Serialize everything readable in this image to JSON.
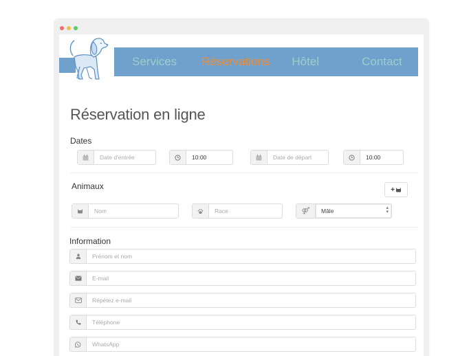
{
  "window": {
    "controls": [
      {
        "name": "close",
        "color": "#f26b6b"
      },
      {
        "name": "minimize",
        "color": "#f5c04a"
      },
      {
        "name": "maximize",
        "color": "#5ccb5f"
      }
    ]
  },
  "colors": {
    "nav_bar": "#6fa1cc",
    "nav_text": "#9ccfca",
    "nav_active": "#f28c2e"
  },
  "nav": {
    "logo_icon": "dog-logo-icon",
    "items": [
      {
        "label": "Services",
        "active": false
      },
      {
        "label": "Réservations",
        "active": true
      },
      {
        "label": "Hôtel",
        "active": false
      },
      {
        "label": "Contact",
        "active": false
      }
    ]
  },
  "page": {
    "title": "Réservation en ligne"
  },
  "dates": {
    "label": "Dates",
    "arrival_date": {
      "icon": "calendar-icon",
      "placeholder": "Date d'entrée",
      "value": ""
    },
    "arrival_time": {
      "icon": "clock-icon",
      "value": "10:00"
    },
    "departure_date": {
      "icon": "calendar-icon",
      "placeholder": "Date de départ",
      "value": ""
    },
    "departure_time": {
      "icon": "clock-icon",
      "value": "10:00"
    }
  },
  "animals": {
    "label": "Animaux",
    "add_button": {
      "icon": "plus-icon",
      "icon2": "pet-icon"
    },
    "name": {
      "icon": "pet-icon",
      "placeholder": "Nom",
      "value": ""
    },
    "breed": {
      "icon": "paw-icon",
      "placeholder": "Race",
      "value": ""
    },
    "sex": {
      "icon": "gender-icon",
      "selected": "Mâle"
    }
  },
  "information": {
    "label": "Information",
    "fields": [
      {
        "icon": "user-icon",
        "placeholder": "Prénom et nom"
      },
      {
        "icon": "envelope-icon",
        "placeholder": "E-mail"
      },
      {
        "icon": "envelope-outline-icon",
        "placeholder": "Répétez e-mail"
      },
      {
        "icon": "phone-icon",
        "placeholder": "Téléphone"
      },
      {
        "icon": "whatsapp-icon",
        "placeholder": "WhatsApp"
      }
    ]
  }
}
